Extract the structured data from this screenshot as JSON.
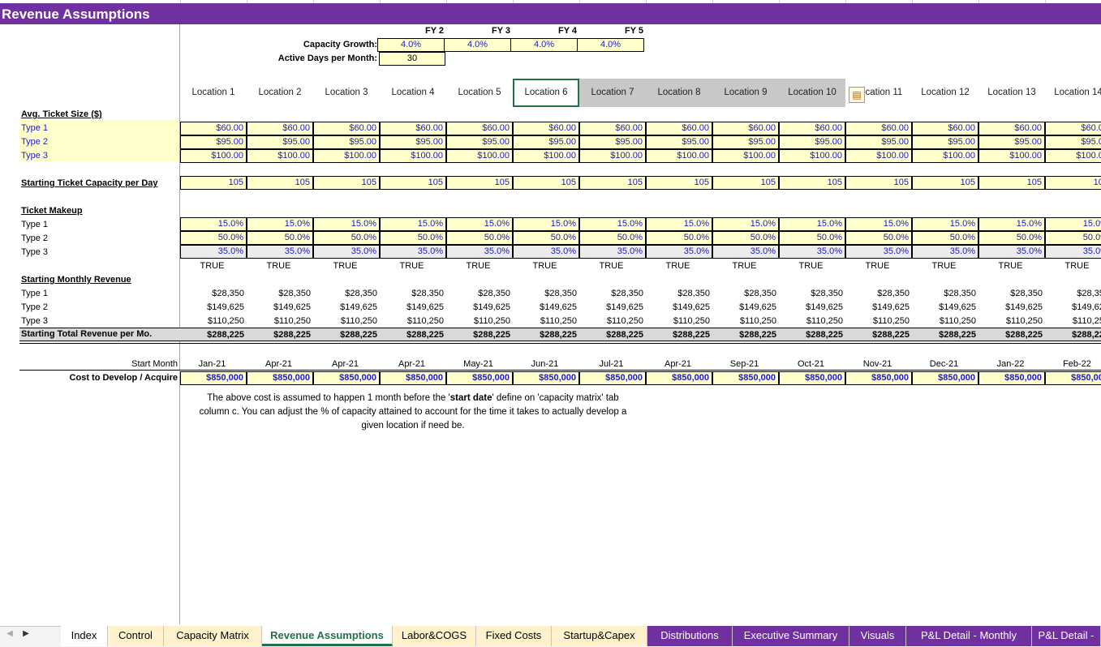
{
  "sheet_title": "Revenue Assumptions",
  "fy_headers": [
    "FY 2",
    "FY 3",
    "FY 4",
    "FY 5"
  ],
  "capacity_growth": {
    "label": "Capacity Growth:",
    "values": [
      "4.0%",
      "4.0%",
      "4.0%",
      "4.0%"
    ]
  },
  "active_days": {
    "label": "Active Days per Month:",
    "value": "30"
  },
  "locations": [
    "Location 1",
    "Location 2",
    "Location 3",
    "Location 4",
    "Location 5",
    "Location 6",
    "Location 7",
    "Location 8",
    "Location 9",
    "Location 10",
    "Location 11",
    "Location 12",
    "Location 13",
    "Location 14"
  ],
  "sections": {
    "avg_ticket": "Avg. Ticket Size ($)",
    "starting_capacity": "Starting Ticket Capacity per Day",
    "ticket_makeup": "Ticket Makeup",
    "starting_monthly_revenue": "Starting Monthly Revenue",
    "total_revenue": "Starting Total Revenue per Mo.",
    "start_month": "Start Month",
    "cost_label": "Cost to Develop / Acquire"
  },
  "type_labels": [
    "Type 1",
    "Type 2",
    "Type 3"
  ],
  "ticket_sizes": [
    "$60.00",
    "$95.00",
    "$100.00"
  ],
  "capacity_value": "105",
  "makeup": [
    "15.0%",
    "50.0%",
    "35.0%"
  ],
  "check_value": "TRUE",
  "monthly_revenue": [
    "$28,350",
    "$149,625",
    "$110,250"
  ],
  "total_revenue": "$288,225",
  "start_months": [
    "Jan-21",
    "Apr-21",
    "Apr-21",
    "Apr-21",
    "May-21",
    "Jun-21",
    "Jul-21",
    "Apr-21",
    "Sep-21",
    "Oct-21",
    "Nov-21",
    "Dec-21",
    "Jan-22",
    "Feb-22"
  ],
  "cost_value": "$850,000",
  "note": {
    "line1_a": "The above cost is assumed to happen 1 month before the '",
    "line1_bold": "start date",
    "line1_b": "' define on 'capacity matrix' tab",
    "line2": "column c. You can adjust the % of capacity attained to account for the time it takes to actually develop a",
    "line3": "given location if need be."
  },
  "sheet_tabs": [
    {
      "label": "Index",
      "style": "plain"
    },
    {
      "label": "Control",
      "style": "yellow"
    },
    {
      "label": "Capacity Matrix",
      "style": "yellow"
    },
    {
      "label": "Revenue Assumptions",
      "style": "active"
    },
    {
      "label": "Labor&COGS",
      "style": "yellow"
    },
    {
      "label": "Fixed Costs",
      "style": "yellow"
    },
    {
      "label": "Startup&Capex",
      "style": "yellow"
    },
    {
      "label": "Distributions",
      "style": "purple"
    },
    {
      "label": "Executive Summary",
      "style": "purple"
    },
    {
      "label": "Visuals",
      "style": "purple"
    },
    {
      "label": "P&L Detail - Monthly",
      "style": "purple"
    },
    {
      "label": "P&L Detail - Annual",
      "style": "purple"
    }
  ],
  "colors": {
    "header_purple": "#7030a0",
    "input_yellow": "#ffffcc",
    "input_blue": "#1a1acc",
    "excel_green": "#217346"
  }
}
